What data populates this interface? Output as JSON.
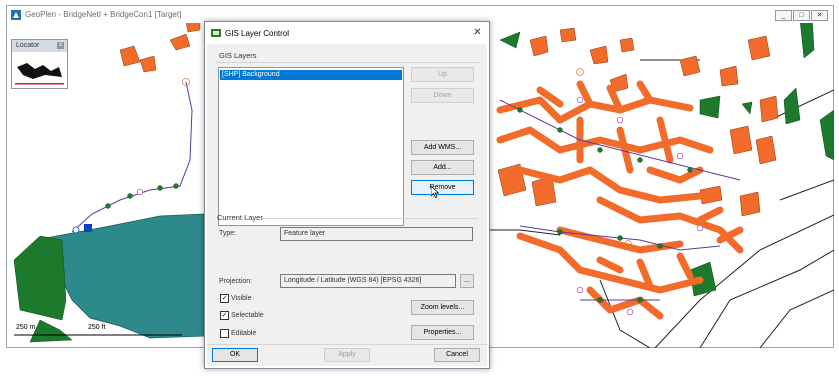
{
  "app": {
    "title": "GeoPlen - BridgeNetI + BridgeCon1 [Target]",
    "window_buttons": [
      "_",
      "□",
      "✕"
    ]
  },
  "locator": {
    "label": "Locator",
    "close": "x"
  },
  "scale": {
    "left_label": "250 m",
    "right_label": "250 ft"
  },
  "dialog": {
    "title": "GIS Layer Control",
    "close_symbol": "✕",
    "gis_layers_label": "GIS Layers",
    "layers": [
      "[SHP] Background"
    ],
    "buttons": {
      "up": "Up",
      "down": "Down",
      "add_wms": "Add WMS...",
      "add": "Add...",
      "remove": "Remove",
      "zoom_levels": "Zoom levels...",
      "properties": "Properties...",
      "browse": "...",
      "ok": "OK",
      "apply": "Apply",
      "cancel": "Cancel"
    },
    "current_layer_label": "Current Layer",
    "type_label": "Type:",
    "type_value": "Feature layer",
    "projection_label": "Projection:",
    "projection_value": "Longitude / Latitude (WGS 84) [EPSG 4326]",
    "checks": {
      "visible": {
        "label": "Visible",
        "checked": true
      },
      "selectable": {
        "label": "Selectable",
        "checked": true
      },
      "editable": {
        "label": "Editable",
        "checked": false
      }
    }
  },
  "colors": {
    "building": "#f26b2a",
    "vegetation": "#1d7a2c",
    "water": "#2e8a8a",
    "pipe": "#5a3aa0",
    "selection": "#0078d7"
  }
}
